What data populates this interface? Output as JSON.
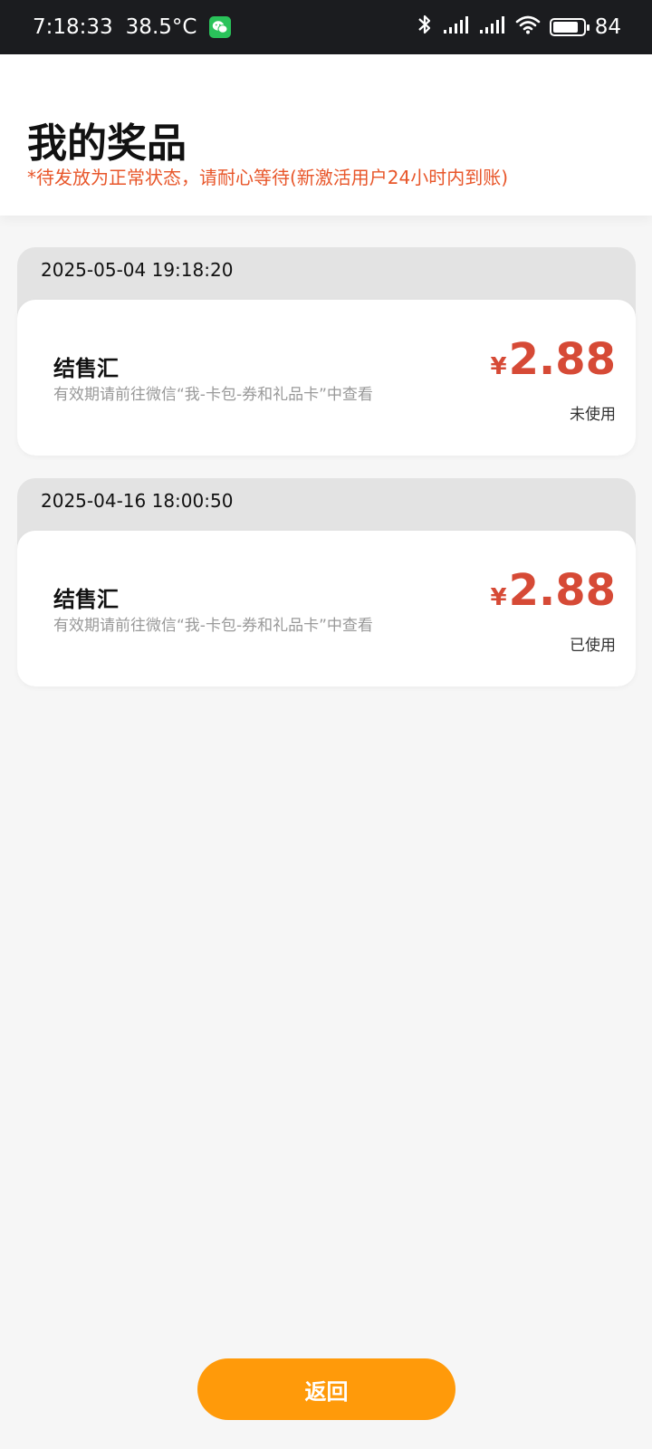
{
  "status_bar": {
    "time": "7:18:33",
    "temperature": "38.5°C",
    "battery": "84",
    "battery_level_percent": 84,
    "icons": [
      "wechat-icon",
      "bluetooth-icon",
      "signal-icon",
      "signal-icon",
      "wifi-icon",
      "battery-icon"
    ]
  },
  "header": {
    "title": "我的奖品",
    "notice": "*待发放为正常状态，请耐心等待(新激活用户24小时内到账)",
    "notice_color": "#e8562a"
  },
  "prizes": [
    {
      "date": "2025-05-04 19:18:20",
      "name": "结售汇",
      "description": "有效期请前往微信“我-卡包-券和礼品卡”中查看",
      "currency": "¥",
      "amount": "2.88",
      "status": "未使用"
    },
    {
      "date": "2025-04-16 18:00:50",
      "name": "结售汇",
      "description": "有效期请前往微信“我-卡包-券和礼品卡”中查看",
      "currency": "¥",
      "amount": "2.88",
      "status": "已使用"
    }
  ],
  "footer": {
    "back_label": "返回",
    "button_color": "#ff9a0a"
  },
  "colors": {
    "amount": "#d64a36",
    "status_bar_bg": "#1b1c1f"
  }
}
